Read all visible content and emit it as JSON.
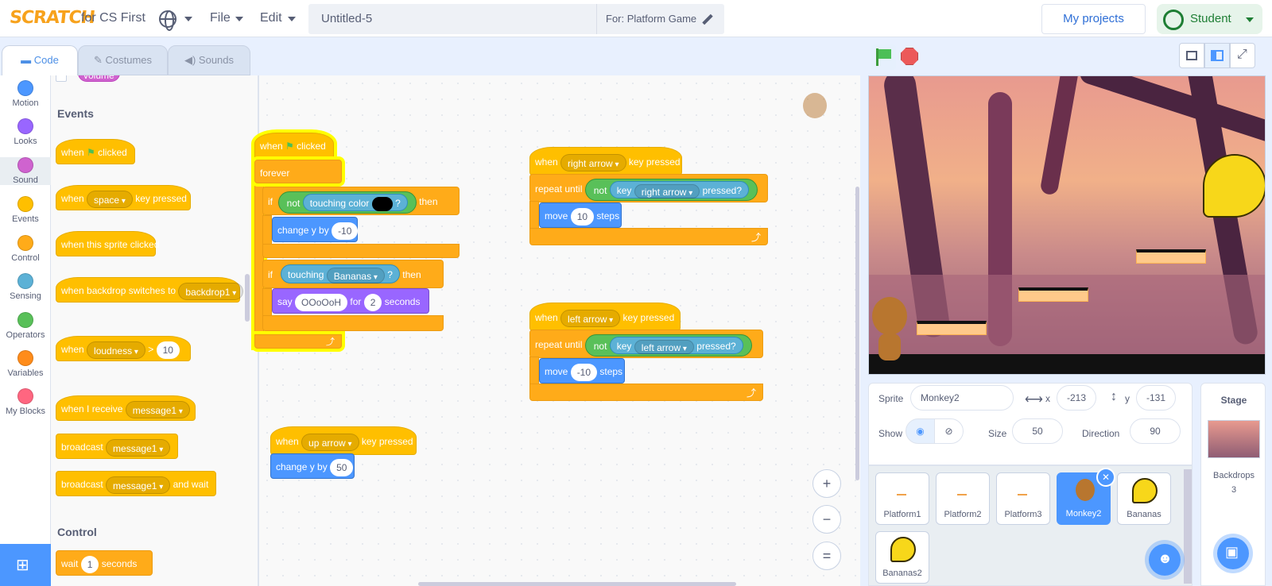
{
  "brand": {
    "logo": "SCRATCH",
    "suffix": "for CS First"
  },
  "menu": {
    "file": "File",
    "edit": "Edit"
  },
  "project": {
    "title": "Untitled-5",
    "for_label": "For: Platform Game"
  },
  "header": {
    "my_projects": "My projects",
    "user": "Student"
  },
  "tabs": [
    {
      "label": "Code"
    },
    {
      "label": "Costumes"
    },
    {
      "label": "Sounds"
    }
  ],
  "categories": [
    {
      "label": "Motion",
      "color": "#4c97ff"
    },
    {
      "label": "Looks",
      "color": "#9966ff"
    },
    {
      "label": "Sound",
      "color": "#cf63cf"
    },
    {
      "label": "Events",
      "color": "#ffbf00"
    },
    {
      "label": "Control",
      "color": "#ffab19"
    },
    {
      "label": "Sensing",
      "color": "#5cb1d6"
    },
    {
      "label": "Operators",
      "color": "#59c059"
    },
    {
      "label": "Variables",
      "color": "#ff8c1a"
    },
    {
      "label": "My Blocks",
      "color": "#ff6680"
    }
  ],
  "palette": {
    "volume": "volume",
    "events_head": "Events",
    "when": "when",
    "clicked": "clicked",
    "space": "space",
    "key_pressed": "key pressed",
    "sprite_clicked": "when this sprite clicked",
    "backdrop_switch": "when backdrop switches to",
    "backdrop1": "backdrop1",
    "loudness": "loudness",
    "gt": ">",
    "ten": "10",
    "when_receive": "when I receive",
    "message1": "message1",
    "broadcast": "broadcast",
    "and_wait": "and wait",
    "control_head": "Control",
    "wait": "wait",
    "one": "1",
    "seconds": "seconds"
  },
  "script": {
    "when": "when",
    "clicked": "clicked",
    "forever": "forever",
    "if": "if",
    "not": "not",
    "touching_color": "touching color",
    "q": "?",
    "then": "then",
    "change_y": "change y by",
    "minus10": "-10",
    "touching": "touching",
    "bananas": "Bananas",
    "say": "say",
    "oooh": "OOoOoH",
    "for": "for",
    "two": "2",
    "seconds": "seconds",
    "right_arrow": "right arrow",
    "key_pressed": "key pressed",
    "repeat_until": "repeat until",
    "key": "key",
    "pressed_q": "pressed?",
    "move": "move",
    "ten": "10",
    "steps": "steps",
    "left_arrow": "left arrow",
    "up_arrow": "up arrow",
    "fifty": "50"
  },
  "sprite_info": {
    "sprite_label": "Sprite",
    "sprite_name": "Monkey2",
    "x_label": "x",
    "x": "-213",
    "y_label": "y",
    "y": "-131",
    "show_label": "Show",
    "size_label": "Size",
    "size": "50",
    "direction_label": "Direction",
    "direction": "90"
  },
  "sprites": [
    {
      "name": "Platform1"
    },
    {
      "name": "Platform2"
    },
    {
      "name": "Platform3"
    },
    {
      "name": "Monkey2"
    },
    {
      "name": "Bananas"
    },
    {
      "name": "Bananas2"
    }
  ],
  "stage_panel": {
    "title": "Stage",
    "backdrops_label": "Backdrops",
    "backdrops_count": "3"
  },
  "zoom": {
    "in": "+",
    "out": "−",
    "reset": "="
  }
}
